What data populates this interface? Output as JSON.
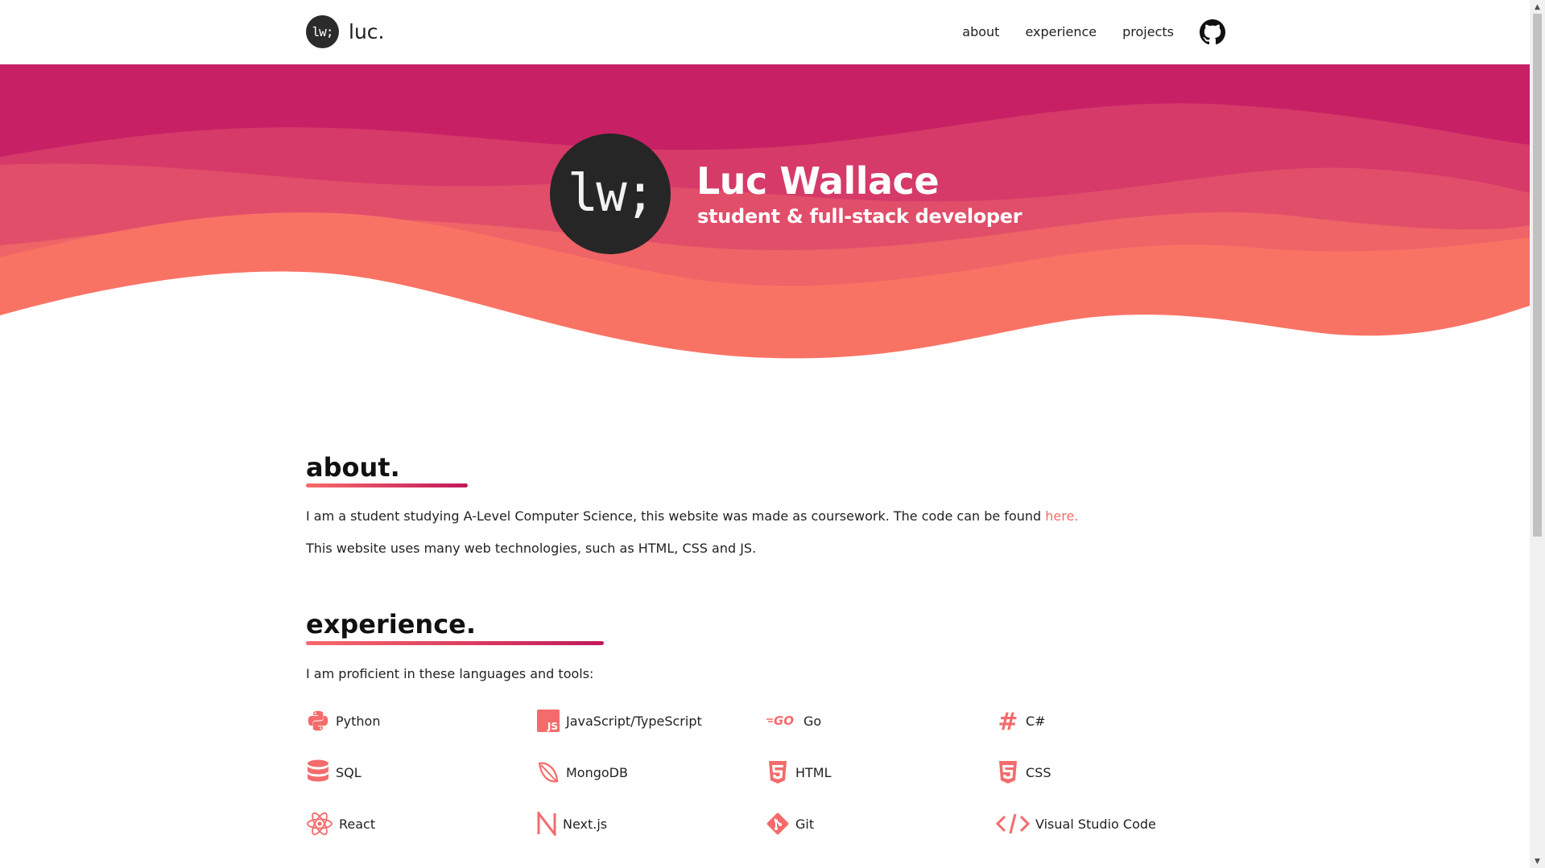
{
  "nav": {
    "brand_logo": "lw;",
    "brand_name": "luc.",
    "links": [
      "about",
      "experience",
      "projects"
    ],
    "github_icon": "github-icon"
  },
  "hero": {
    "avatar_text": "lw;",
    "name": "Luc Wallace",
    "subtitle": "student & full-stack developer",
    "colors": {
      "top": "#c72065",
      "middle": "#e14e6a",
      "bottom": "#f97365"
    }
  },
  "about": {
    "title": "about.",
    "line1": "I am a student studying A-Level Computer Science, this website was made as coursework. The code can be found ",
    "line1_link": "here.",
    "line2": "This website uses many web technologies, such as HTML, CSS and JS."
  },
  "experience": {
    "title": "experience.",
    "intro": "I am proficient in these languages and tools:",
    "skills": [
      {
        "label": "Python",
        "icon": "python-icon"
      },
      {
        "label": "JavaScript/TypeScript",
        "icon": "javascript-icon"
      },
      {
        "label": "Go",
        "icon": "go-icon"
      },
      {
        "label": "C#",
        "icon": "csharp-icon"
      },
      {
        "label": "SQL",
        "icon": "database-icon"
      },
      {
        "label": "MongoDB",
        "icon": "mongodb-leaf-icon"
      },
      {
        "label": "HTML",
        "icon": "html5-icon"
      },
      {
        "label": "CSS",
        "icon": "css3-icon"
      },
      {
        "label": "React",
        "icon": "react-icon"
      },
      {
        "label": "Next.js",
        "icon": "nextjs-icon"
      },
      {
        "label": "Git",
        "icon": "git-icon"
      },
      {
        "label": "Visual Studio Code",
        "icon": "code-icon"
      }
    ],
    "accent_color": "#f46b6b"
  }
}
